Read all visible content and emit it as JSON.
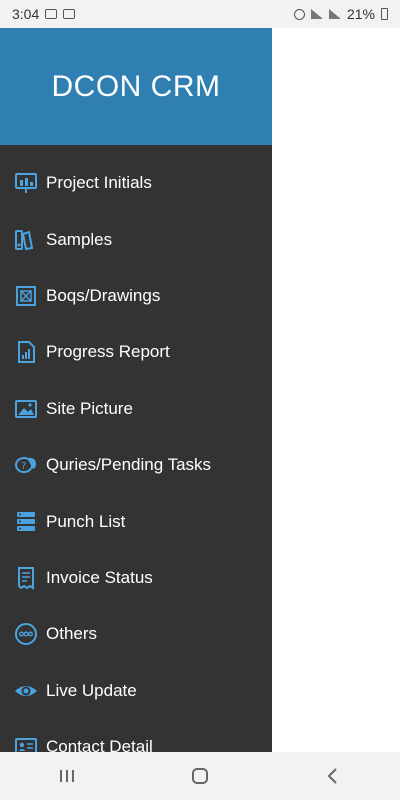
{
  "status_bar": {
    "time": "3:04",
    "battery": "21%"
  },
  "drawer": {
    "title": "DCON CRM",
    "items": [
      {
        "label": "Project Initials",
        "icon": "chart-icon"
      },
      {
        "label": "Samples",
        "icon": "swatches-icon"
      },
      {
        "label": "Boqs/Drawings",
        "icon": "blueprint-icon"
      },
      {
        "label": "Progress Report",
        "icon": "report-icon"
      },
      {
        "label": "Site Picture",
        "icon": "picture-icon"
      },
      {
        "label": "Quries/Pending Tasks",
        "icon": "chat-question-icon"
      },
      {
        "label": "Punch List",
        "icon": "list-icon"
      },
      {
        "label": "Invoice Status",
        "icon": "invoice-icon"
      },
      {
        "label": "Others",
        "icon": "more-icon"
      },
      {
        "label": "Live Update",
        "icon": "eye-icon"
      },
      {
        "label": "Contact Detail",
        "icon": "contact-card-icon"
      }
    ]
  },
  "colors": {
    "accent": "#2f7fb3",
    "drawer_bg": "#333333",
    "icon": "#4aa3df"
  }
}
